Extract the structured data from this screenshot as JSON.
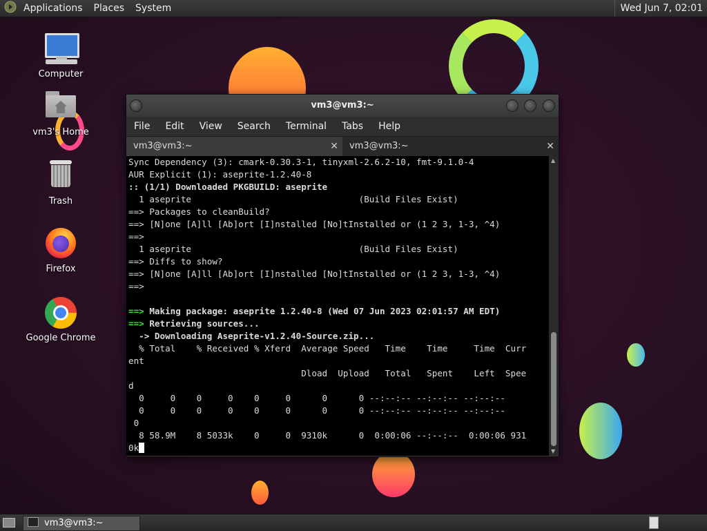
{
  "top_panel": {
    "applications": "Applications",
    "places": "Places",
    "system": "System",
    "clock": "Wed Jun  7, 02:01"
  },
  "desktop_icons": [
    {
      "label": "Computer",
      "icon": "computer-icon"
    },
    {
      "label": "vm3's Home",
      "icon": "home-folder-icon"
    },
    {
      "label": "Trash",
      "icon": "trash-icon"
    },
    {
      "label": "Firefox",
      "icon": "firefox-icon"
    },
    {
      "label": "Google Chrome",
      "icon": "chrome-icon"
    }
  ],
  "terminal": {
    "title": "vm3@vm3:~",
    "menu": [
      "File",
      "Edit",
      "View",
      "Search",
      "Terminal",
      "Tabs",
      "Help"
    ],
    "tabs": [
      {
        "label": "vm3@vm3:~"
      },
      {
        "label": "vm3@vm3:~"
      }
    ],
    "lines": [
      "Sync Dependency (3): cmark-0.30.3-1, tinyxml-2.6.2-10, fmt-9.1.0-4",
      "AUR Explicit (1): aseprite-1.2.40-8",
      ":: (1/1) Downloaded PKGBUILD: aseprite",
      "  1 aseprite                                (Build Files Exist)",
      "==> Packages to cleanBuild?",
      "==> [N]one [A]ll [Ab]ort [I]nstalled [No]tInstalled or (1 2 3, 1-3, ^4)",
      "==> ",
      "  1 aseprite                                (Build Files Exist)",
      "==> Diffs to show?",
      "==> [N]one [A]ll [Ab]ort [I]nstalled [No]tInstalled or (1 2 3, 1-3, ^4)",
      "==> ",
      "",
      "==> Making package: aseprite 1.2.40-8 (Wed 07 Jun 2023 02:01:57 AM EDT)",
      "==> Retrieving sources...",
      "  -> Downloading Aseprite-v1.2.40-Source.zip...",
      "  % Total    % Received % Xferd  Average Speed   Time    Time     Time  Curr",
      "ent",
      "                                 Dload  Upload   Total   Spent    Left  Spee",
      "d",
      "  0     0    0     0    0     0      0      0 --:--:-- --:--:-- --:--:--",
      "  0     0    0     0    0     0      0      0 --:--:-- --:--:-- --:--:--",
      " 0",
      "  8 58.9M    8 5033k    0     0  9310k      0  0:00:06 --:--:--  0:00:06 931",
      "0k"
    ]
  },
  "taskbar": {
    "task_label": "vm3@vm3:~"
  }
}
